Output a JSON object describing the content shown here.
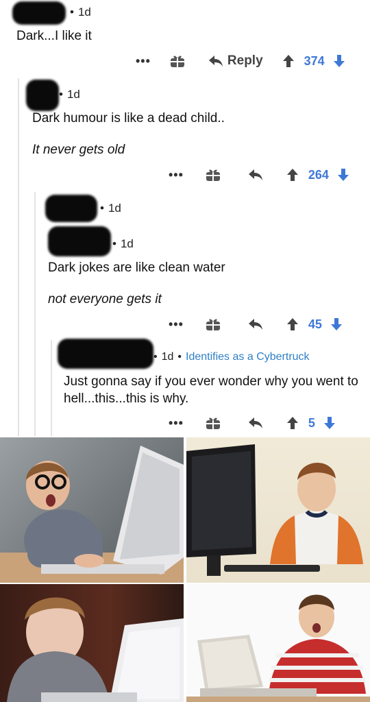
{
  "comments": [
    {
      "time": "1d",
      "body": "Dark...I like it",
      "reply_label": "Reply",
      "score": "374"
    },
    {
      "time": "1d",
      "body_line1": "Dark humour is like a dead child..",
      "body_line2": "It never gets old",
      "score": "264"
    },
    {
      "time": "1d",
      "time2": "1d",
      "body_line1": "Dark jokes are like clean water",
      "body_line2": "not everyone gets it",
      "score": "45"
    },
    {
      "time": "1d",
      "flair": "Identifies as a Cybertruck",
      "body": "Just gonna say if you ever wonder why you went to hell...this...this is why.",
      "score": "5"
    }
  ],
  "icons": {
    "more": "more-icon",
    "gift": "gift-icon",
    "reply": "reply-icon",
    "upvote": "upvote-icon",
    "downvote": "downvote-icon"
  },
  "colors": {
    "score": "#3e78d6",
    "flair": "#2e7fc6",
    "accent_orange": "#e0742c"
  },
  "images": [
    "shocked-boy-glasses-laptop",
    "smiling-boy-desktop-computer",
    "boy-glowing-laptop",
    "excited-boy-striped-shirt-laptop"
  ]
}
